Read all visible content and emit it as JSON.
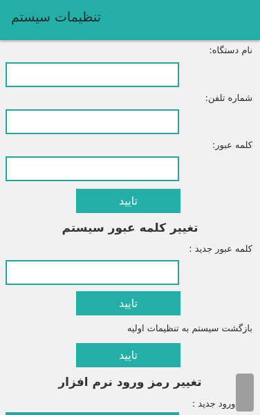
{
  "appbar": {
    "title": "تنظیمات سیستم"
  },
  "form": {
    "device_name_label": "نام دستگاه:",
    "device_name_value": "",
    "phone_label": "شماره تلفن:",
    "phone_value": "",
    "password_label": "کلمه عبور:",
    "password_value": "",
    "submit_label": "تایید"
  },
  "change_password": {
    "heading": "تغییر کلمه عبور سیستم",
    "new_password_label": "کلمه عبور جدید :",
    "new_password_value": "",
    "submit_label": "تایید"
  },
  "reset": {
    "text": "بازگشت سیستم به تنظیمات اولیه",
    "submit_label": "تایید"
  },
  "software_password": {
    "heading": "تغییر رمز ورود نرم افزار",
    "new_code_label": "رمز ورود جدید :"
  },
  "icons": {
    "scroll_thumb": "scroll-thumb-icon"
  }
}
